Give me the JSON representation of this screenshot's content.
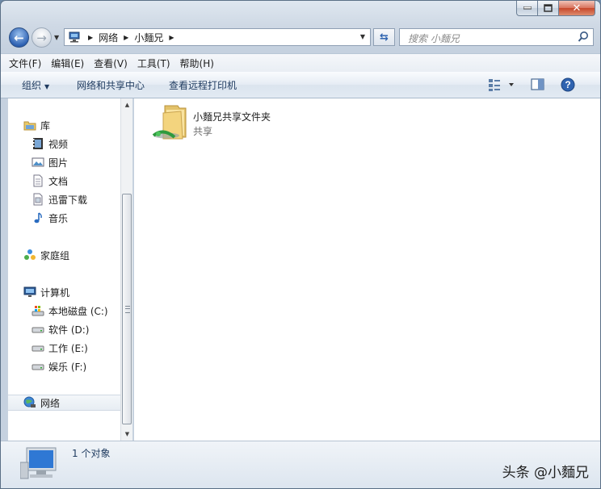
{
  "window": {
    "caption_buttons": {
      "minimize": "▭",
      "maximize": "□",
      "close": "✕"
    }
  },
  "address": {
    "crumbs": [
      "网络",
      "小麵兄"
    ]
  },
  "search": {
    "placeholder": "搜索 小麵兄"
  },
  "menu": [
    "文件(F)",
    "编辑(E)",
    "查看(V)",
    "工具(T)",
    "帮助(H)"
  ],
  "commands": {
    "organize": "组织",
    "network_center": "网络和共享中心",
    "printers": "查看远程打印机"
  },
  "nav": {
    "library": "库",
    "library_items": [
      "视频",
      "图片",
      "文档",
      "迅雷下载",
      "音乐"
    ],
    "homegroup": "家庭组",
    "computer": "计算机",
    "drives": [
      "本地磁盘 (C:)",
      "软件 (D:)",
      "工作 (E:)",
      "娱乐 (F:)"
    ],
    "network": "网络"
  },
  "content": {
    "items": [
      {
        "name": "小麵兄共享文件夹",
        "type": "共享"
      }
    ]
  },
  "status": {
    "count": "1 个对象"
  },
  "watermark": "头条 @小麵兄"
}
